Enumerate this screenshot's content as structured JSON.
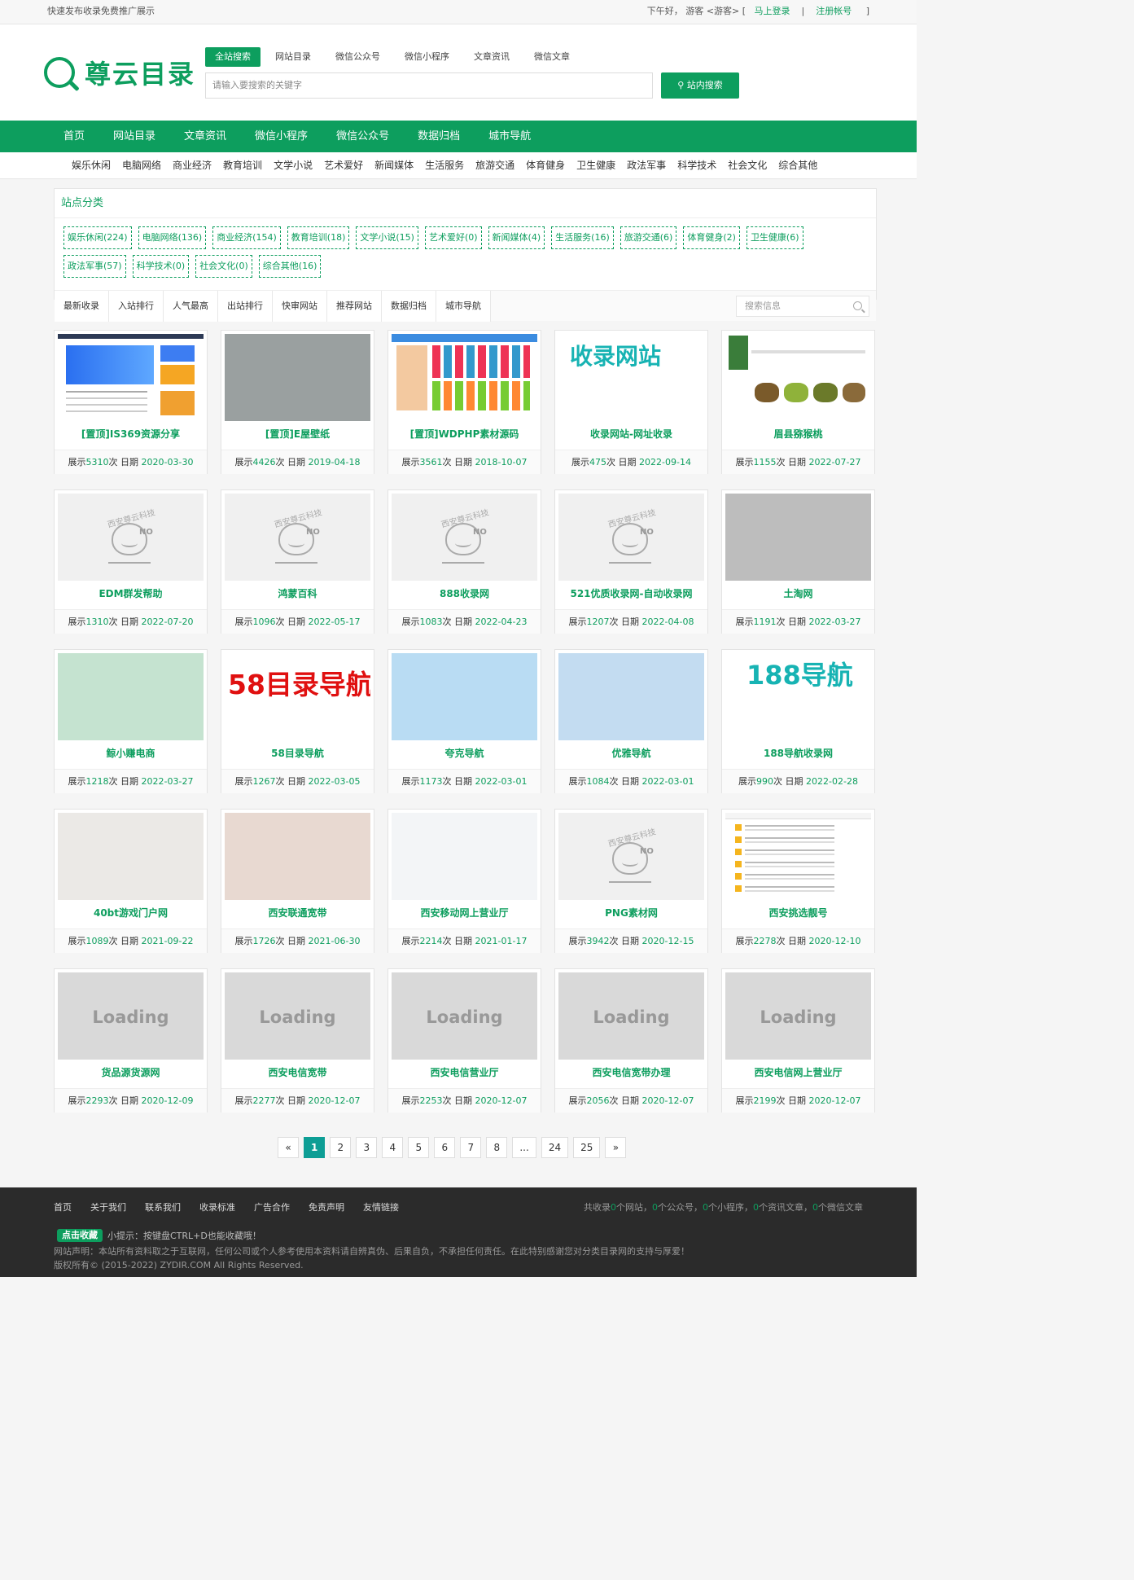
{
  "topbar": {
    "left": [
      "快速发布收录",
      "免费推广展示"
    ],
    "greeting": "下午好，",
    "visitor": "游客 <游客> [",
    "login": "马上登录",
    "sep": "|",
    "register": "注册帐号",
    "close": "]"
  },
  "logo": {
    "text": "尊云目录"
  },
  "search": {
    "tabs": [
      "全站搜索",
      "网站目录",
      "微信公众号",
      "微信小程序",
      "文章资讯",
      "微信文章"
    ],
    "placeholder": "请输入要搜索的关键字",
    "button": "站内搜索"
  },
  "nav": [
    "首页",
    "网站目录",
    "文章资讯",
    "微信小程序",
    "微信公众号",
    "数据归档",
    "城市导航"
  ],
  "subnav": [
    "娱乐休闲",
    "电脑网络",
    "商业经济",
    "教育培训",
    "文学小说",
    "艺术爱好",
    "新闻媒体",
    "生活服务",
    "旅游交通",
    "体育健身",
    "卫生健康",
    "政法军事",
    "科学技术",
    "社会文化",
    "综合其他"
  ],
  "categories": {
    "title": "站点分类",
    "items": [
      "娱乐休闲(224)",
      "电脑网络(136)",
      "商业经济(154)",
      "教育培训(18)",
      "文学小说(15)",
      "艺术爱好(0)",
      "新闻媒体(4)",
      "生活服务(16)",
      "旅游交通(6)",
      "体育健身(2)",
      "卫生健康(6)",
      "政法军事(57)",
      "科学技术(0)",
      "社会文化(0)",
      "综合其他(16)"
    ]
  },
  "tabs": [
    "最新收录",
    "入站排行",
    "人气最高",
    "出站排行",
    "快审网站",
    "推荐网站",
    "数据归档",
    "城市导航"
  ],
  "tab_search_placeholder": "搜索信息",
  "labels": {
    "views": "展示",
    "times": "次 日期"
  },
  "sites": [
    {
      "name": "[置顶]IS369资源分享",
      "views": "5310",
      "date": "2020-03-30",
      "thumb": "shot1"
    },
    {
      "name": "[置顶]E屋壁纸",
      "views": "4426",
      "date": "2019-04-18",
      "thumb": "gray"
    },
    {
      "name": "[置顶]WDPHP素材源码",
      "views": "3561",
      "date": "2018-10-07",
      "thumb": "shot2"
    },
    {
      "name": "收录网站-网址收录",
      "views": "475",
      "date": "2022-09-14",
      "thumb": "text1",
      "thumb_text": "收录网站"
    },
    {
      "name": "眉县猕猴桃",
      "views": "1155",
      "date": "2022-07-27",
      "thumb": "shot3"
    },
    {
      "name": "EDM群发帮助",
      "views": "1310",
      "date": "2022-07-20",
      "thumb": "noimg"
    },
    {
      "name": "鸿蒙百科",
      "views": "1096",
      "date": "2022-05-17",
      "thumb": "noimg"
    },
    {
      "name": "888收录网",
      "views": "1083",
      "date": "2022-04-23",
      "thumb": "noimg"
    },
    {
      "name": "521优质收录网-自动收录网",
      "views": "1207",
      "date": "2022-04-08",
      "thumb": "noimg"
    },
    {
      "name": "土淘网",
      "views": "1191",
      "date": "2022-03-27",
      "thumb": "gray2"
    },
    {
      "name": "鲸小赚电商",
      "views": "1218",
      "date": "2022-03-27",
      "thumb": "green"
    },
    {
      "name": "58目录导航",
      "views": "1267",
      "date": "2022-03-05",
      "thumb": "text2",
      "thumb_text": "58目录导航"
    },
    {
      "name": "夸克导航",
      "views": "1173",
      "date": "2022-03-01",
      "thumb": "blue"
    },
    {
      "name": "优雅导航",
      "views": "1084",
      "date": "2022-03-01",
      "thumb": "blue2"
    },
    {
      "name": "188导航收录网",
      "views": "990",
      "date": "2022-02-28",
      "thumb": "text3",
      "thumb_text": "188导航"
    },
    {
      "name": "40bt游戏门户网",
      "views": "1089",
      "date": "2021-09-22",
      "thumb": "lightgray"
    },
    {
      "name": "西安联通宽带",
      "views": "1726",
      "date": "2021-06-30",
      "thumb": "pink"
    },
    {
      "name": "西安移动网上营业厅",
      "views": "2214",
      "date": "2021-01-17",
      "thumb": "verylight"
    },
    {
      "name": "PNG素材网",
      "views": "3942",
      "date": "2020-12-15",
      "thumb": "noimg"
    },
    {
      "name": "西安挑选靓号",
      "views": "2278",
      "date": "2020-12-10",
      "thumb": "shot4"
    },
    {
      "name": "货品源货源网",
      "views": "2293",
      "date": "2020-12-09",
      "thumb": "loading"
    },
    {
      "name": "西安电信宽带",
      "views": "2277",
      "date": "2020-12-07",
      "thumb": "loading"
    },
    {
      "name": "西安电信营业厅",
      "views": "2253",
      "date": "2020-12-07",
      "thumb": "loading"
    },
    {
      "name": "西安电信宽带办理",
      "views": "2056",
      "date": "2020-12-07",
      "thumb": "loading"
    },
    {
      "name": "西安电信网上营业厅",
      "views": "2199",
      "date": "2020-12-07",
      "thumb": "loading"
    }
  ],
  "noimg_label": "西安尊云科技",
  "noimg_no": "NO",
  "loading_text": "Loading",
  "pager": [
    "«",
    "1",
    "2",
    "3",
    "4",
    "5",
    "6",
    "7",
    "8",
    "...",
    "24",
    "25",
    "»"
  ],
  "pager_current": "1",
  "footer": {
    "links": [
      "首页",
      "关于我们",
      "联系我们",
      "收录标准",
      "广告合作",
      "免责声明",
      "友情链接"
    ],
    "stats": {
      "p1": "共收录",
      "n1": "0",
      "p2": "个网站，",
      "n2": "0",
      "p3": "个公众号，",
      "n3": "0",
      "p4": "个小程序，",
      "n4": "0",
      "p5": "个资讯文章，",
      "n5": "0",
      "p6": "个微信文章"
    },
    "fav_button": "点击收藏",
    "tip": "小提示：按键盘CTRL+D也能收藏哦！",
    "declaration": "网站声明：本站所有资料取之于互联网，任何公司或个人参考使用本资料请自辨真伪、后果自负，不承担任何责任。在此特别感谢您对分类目录网的支持与厚爱！",
    "copyright": "版权所有© (2015-2022) ZYDIR.COM All Rights Reserved."
  },
  "colors": {
    "brand": "#0d9e5e",
    "pager_active": "#0d9e95"
  }
}
